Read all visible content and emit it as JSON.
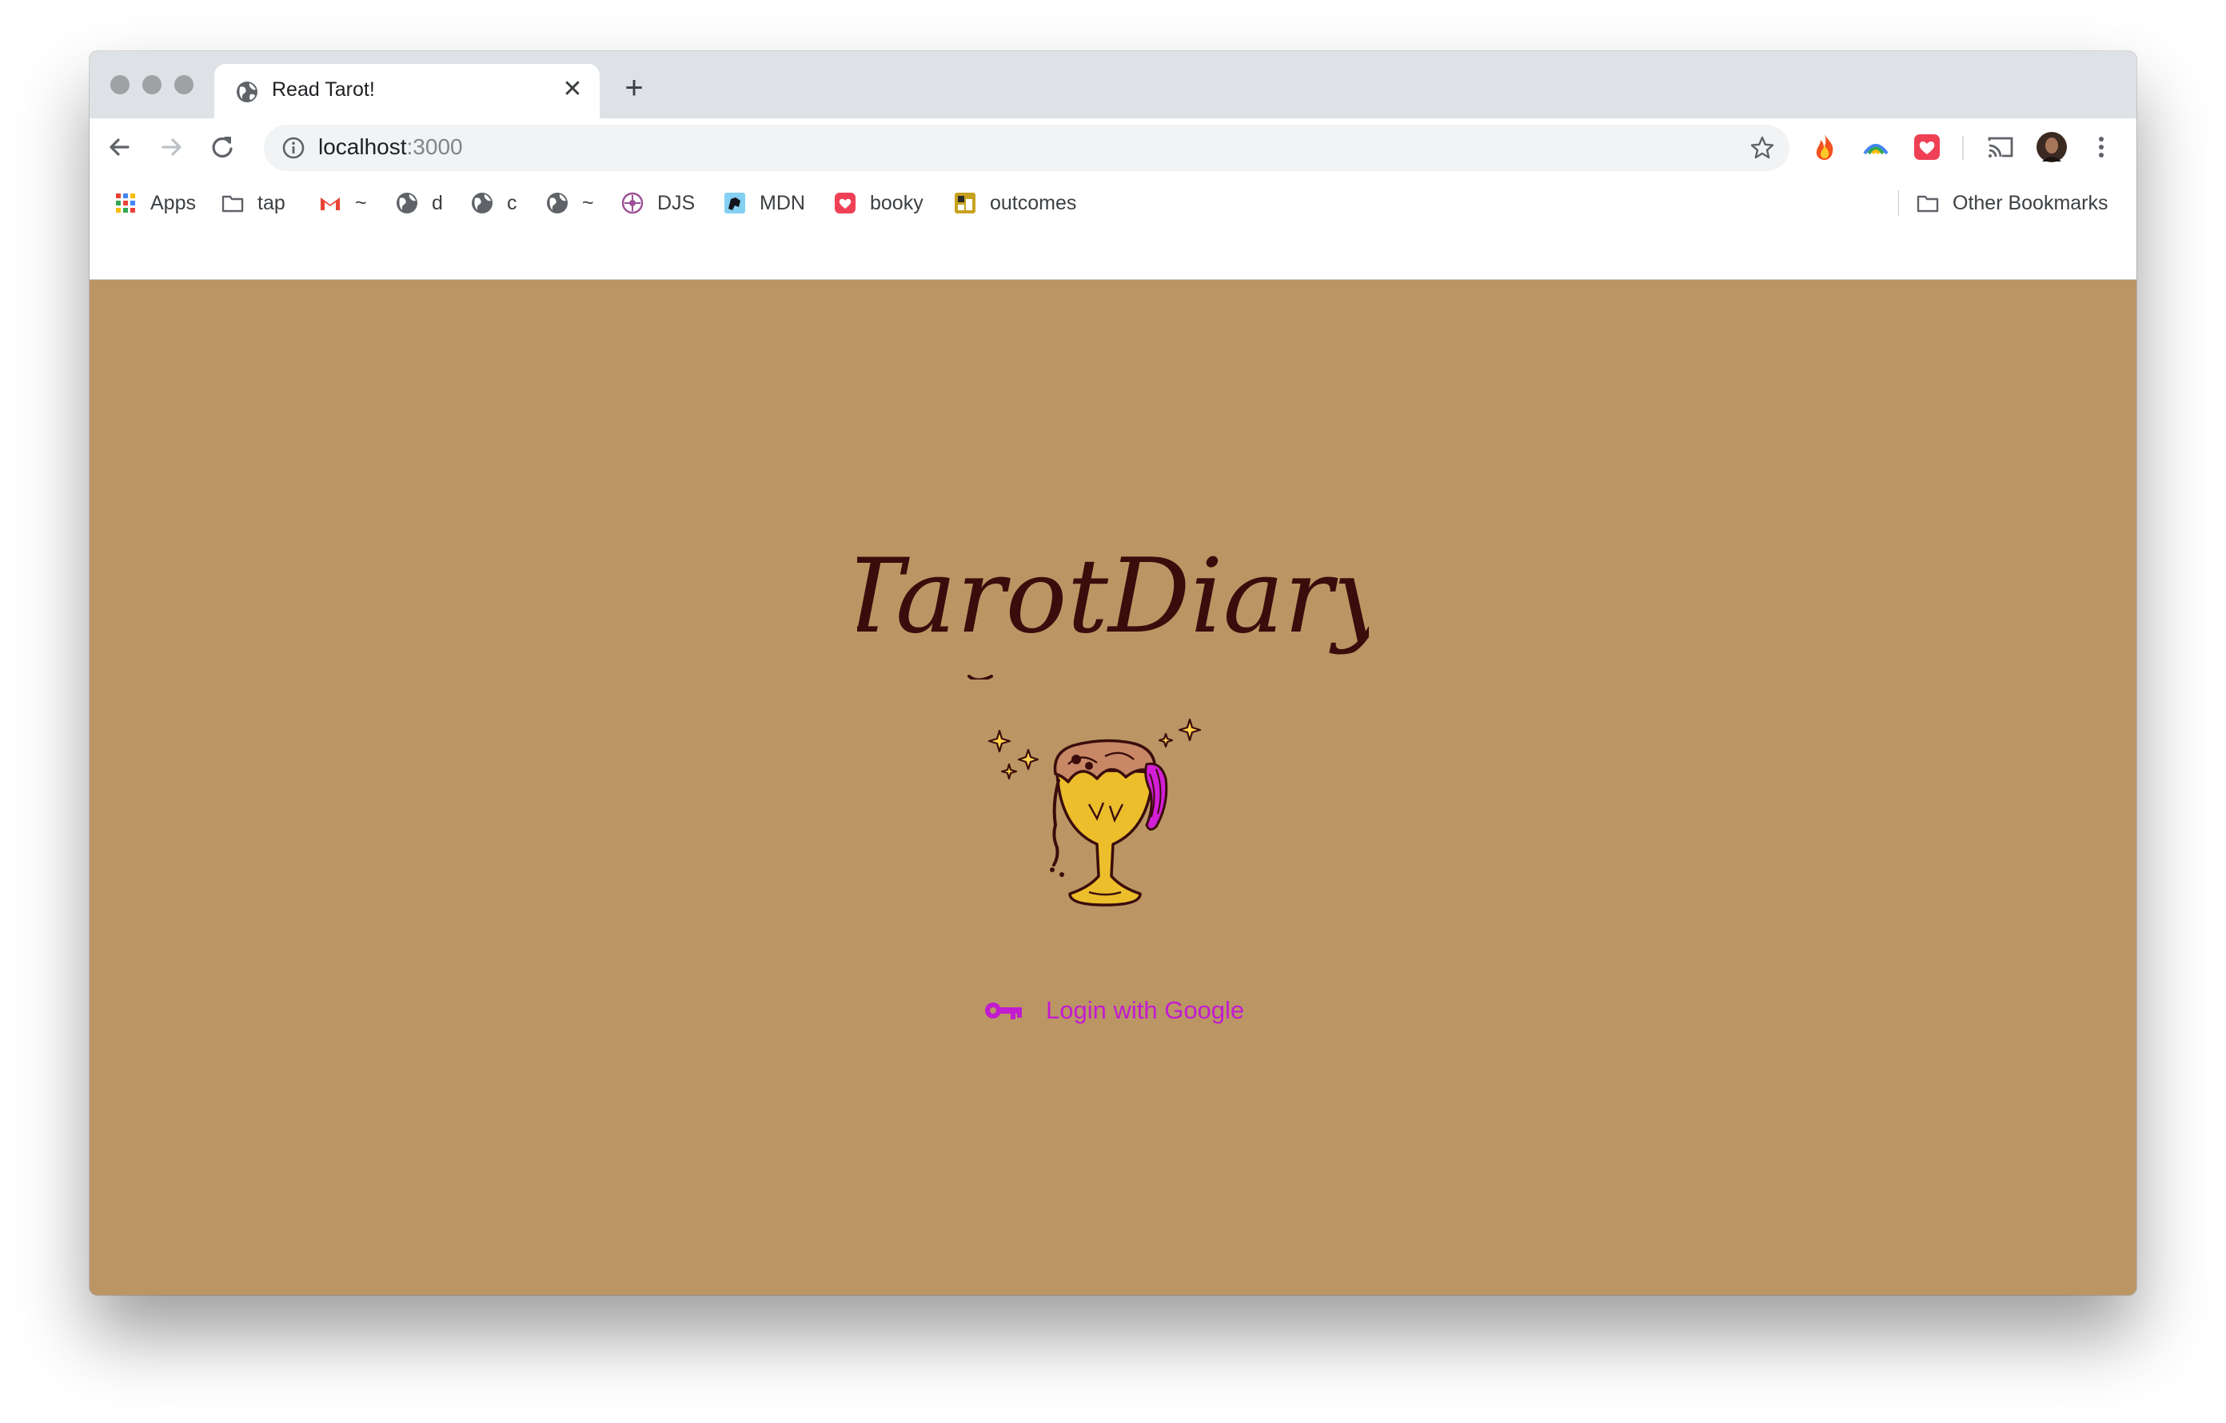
{
  "browser": {
    "tab": {
      "title": "Read Tarot!",
      "close": "✕"
    },
    "new_tab": "+",
    "address": {
      "host": "localhost",
      "port": ":3000"
    },
    "bookmarks": [
      {
        "label": "Apps",
        "icon": "apps-grid-icon"
      },
      {
        "label": "tap",
        "icon": "folder-icon"
      },
      {
        "label": "~",
        "icon": "gmail-icon"
      },
      {
        "label": "d",
        "icon": "globe-icon"
      },
      {
        "label": "c",
        "icon": "globe-icon"
      },
      {
        "label": "~",
        "icon": "globe-icon"
      },
      {
        "label": "DJS",
        "icon": "djs-icon"
      },
      {
        "label": "MDN",
        "icon": "mdn-icon"
      },
      {
        "label": "booky",
        "icon": "booky-icon"
      },
      {
        "label": "outcomes",
        "icon": "outcomes-icon"
      }
    ],
    "other_bookmarks": "Other Bookmarks"
  },
  "page": {
    "logo_text": "TarotDiary",
    "login_label": "Login with Google",
    "background_color": "#bb9664",
    "accent_color": "#c21bd0",
    "logo_color": "#3a0c0c"
  }
}
